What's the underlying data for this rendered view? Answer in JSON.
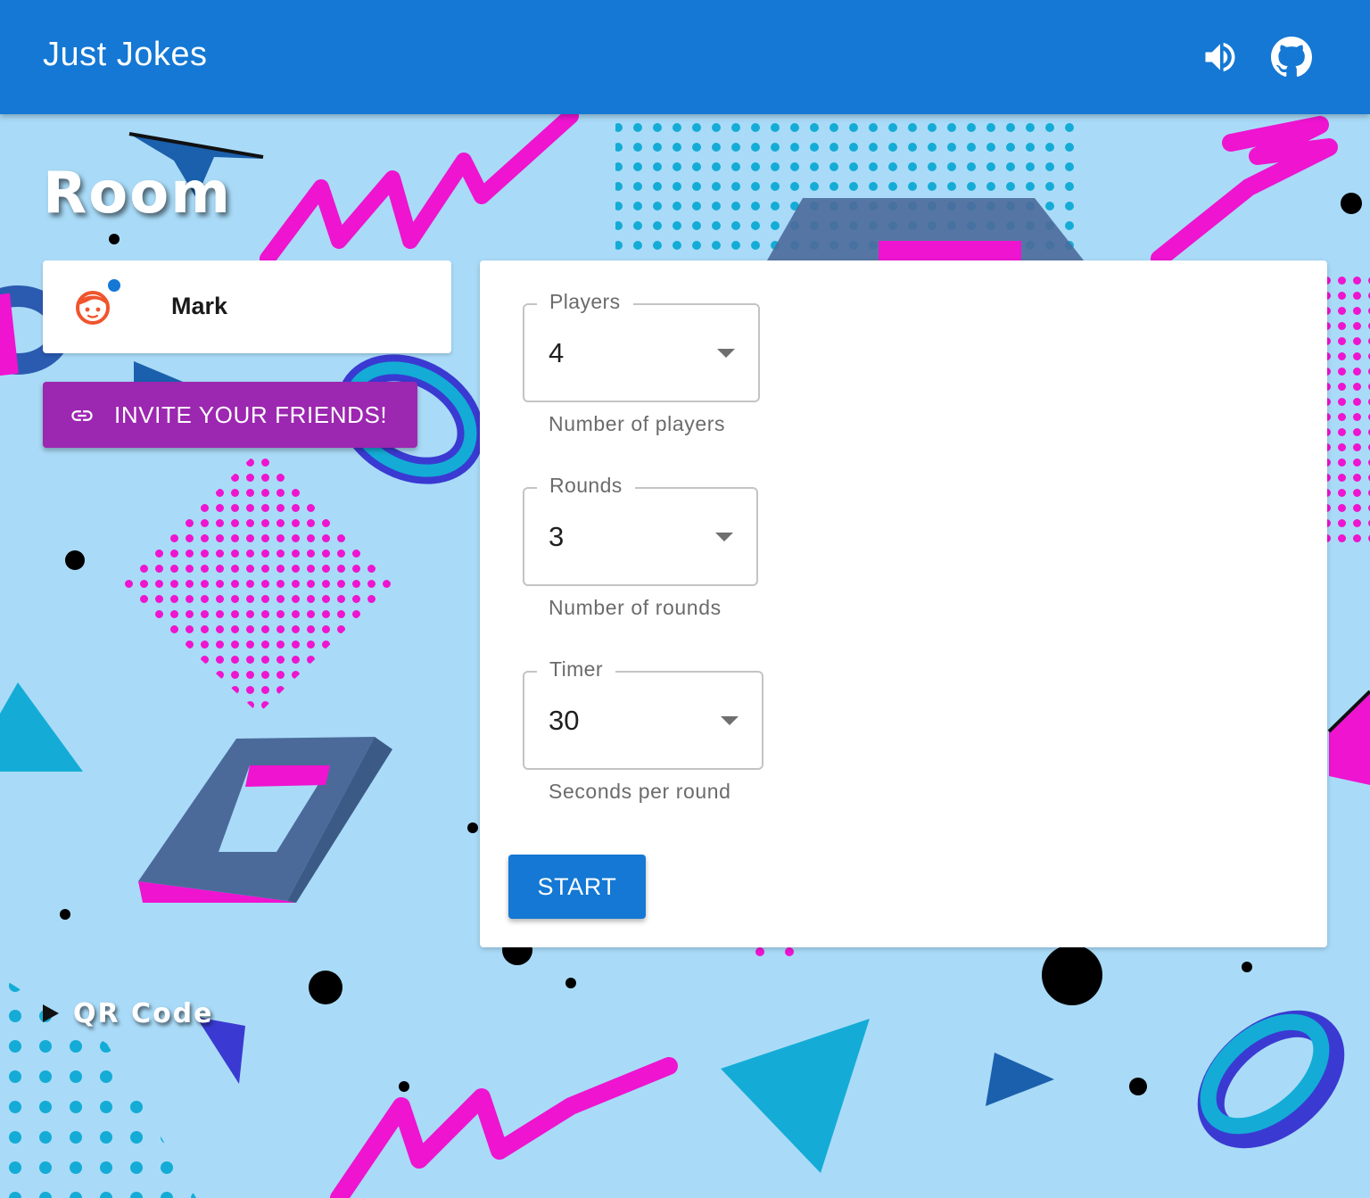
{
  "app": {
    "title": "Just Jokes"
  },
  "header": {
    "sound_icon": "volume-up-icon",
    "github_icon": "github-icon"
  },
  "room": {
    "title": "Room"
  },
  "players": [
    {
      "name": "Mark",
      "avatar_icon": "child-face-icon",
      "online": true
    }
  ],
  "invite": {
    "label": "INVITE YOUR FRIENDS!",
    "icon": "link-icon"
  },
  "settings": {
    "players": {
      "label": "Players",
      "value": "4",
      "helper": "Number of players"
    },
    "rounds": {
      "label": "Rounds",
      "value": "3",
      "helper": "Number of rounds"
    },
    "timer": {
      "label": "Timer",
      "value": "30",
      "helper": "Seconds per round"
    },
    "start_label": "START"
  },
  "qr": {
    "label": "QR Code"
  },
  "colors": {
    "appbar": "#1478d4",
    "invite": "#9c27b0",
    "start": "#1478d4",
    "background": "#a9dbf8",
    "accent_pink": "#ee14d0",
    "accent_cyan": "#14acd6"
  }
}
